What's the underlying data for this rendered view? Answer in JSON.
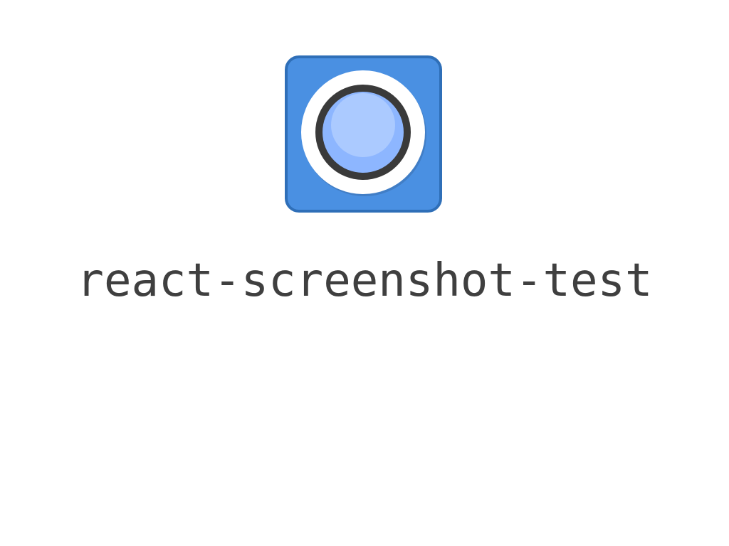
{
  "app": {
    "title": "react-screenshot-test",
    "logo_icon": "camera-lens-icon"
  },
  "colors": {
    "logo_background": "#4a90e2",
    "logo_border": "#2f6fb8",
    "lens_ring_white": "#ffffff",
    "lens_ring_dark": "#3a3a3a",
    "lens_center": "#8db6ff",
    "lens_highlight": "#b5d0ff",
    "title_text": "#3f3f3f",
    "page_background": "#ffffff"
  }
}
